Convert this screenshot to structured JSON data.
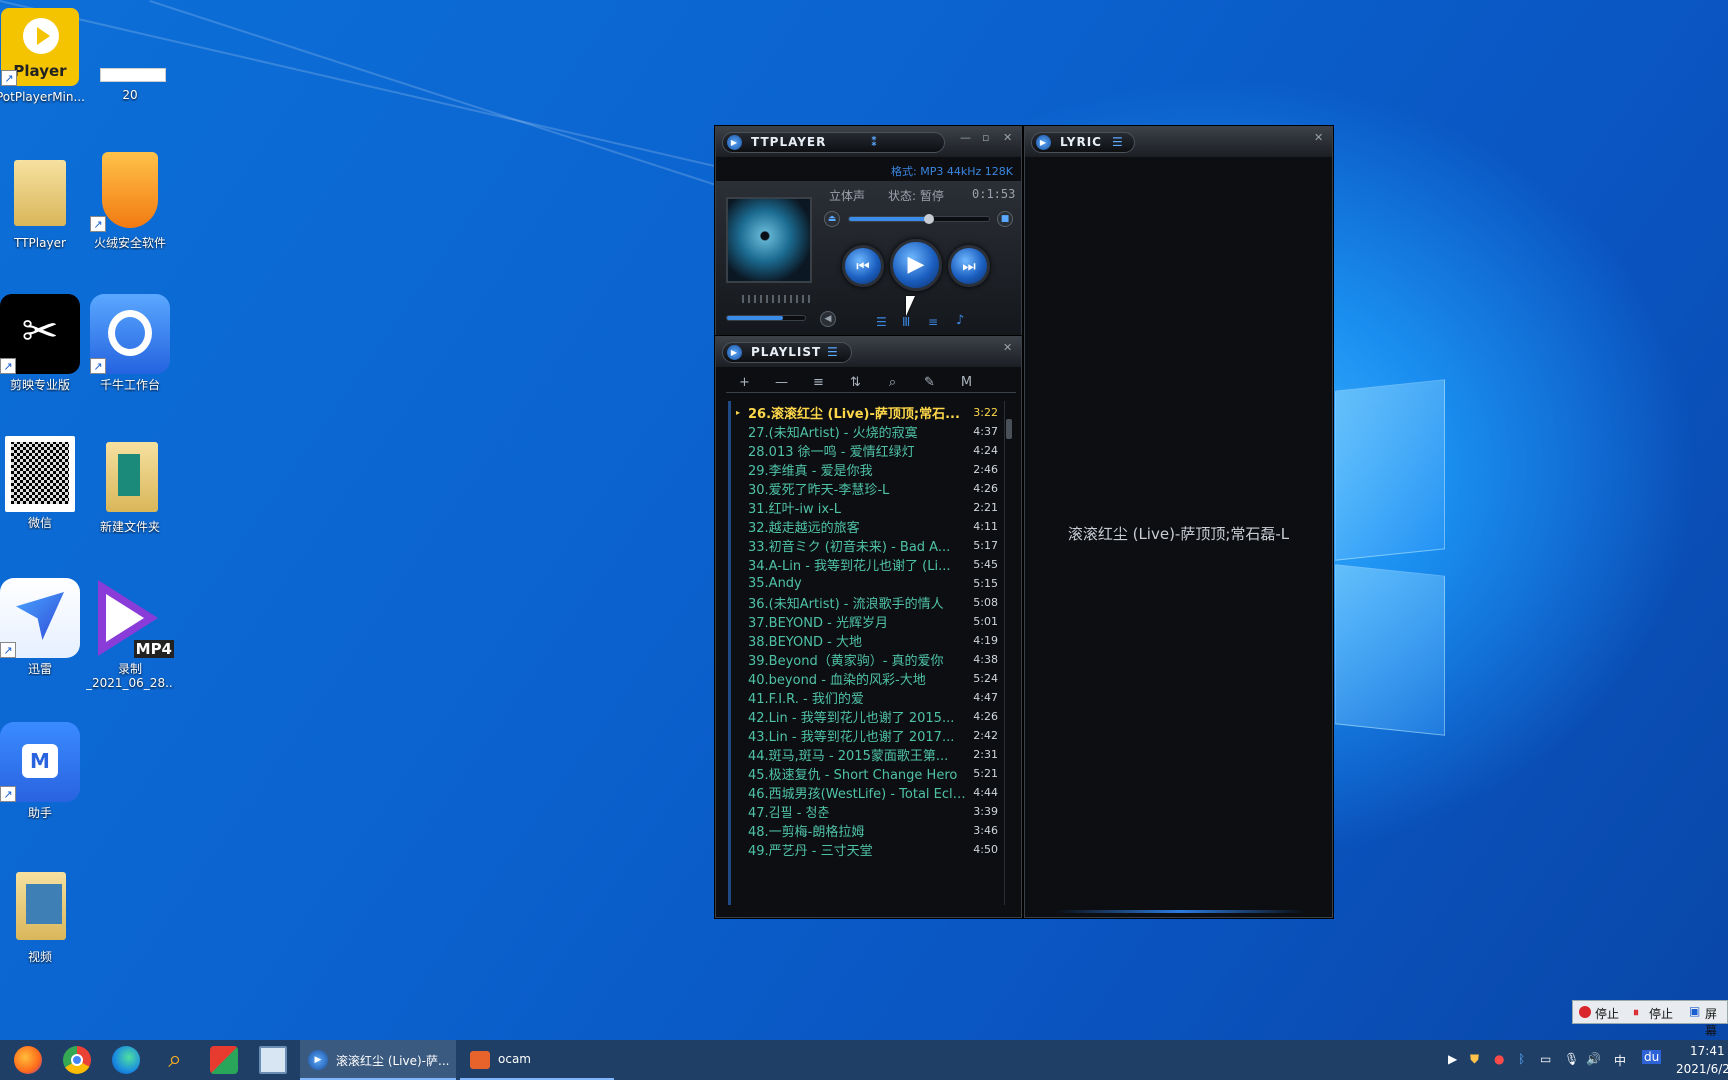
{
  "desktop_icons": [
    {
      "label": "PotPlayerMin...",
      "tile_text": "Player",
      "has_shortcut": true
    },
    {
      "label": "20",
      "has_shortcut": false
    },
    {
      "label": "TTPlayer",
      "has_shortcut": false
    },
    {
      "label": "火绒安全软件",
      "has_shortcut": true
    },
    {
      "label": "剪映专业版",
      "has_shortcut": true
    },
    {
      "label": "千牛工作台",
      "has_shortcut": true
    },
    {
      "label": "微信",
      "has_shortcut": false
    },
    {
      "label": "新建文件夹",
      "has_shortcut": false
    },
    {
      "label": "迅雷",
      "has_shortcut": true
    },
    {
      "label": "录制\n_2021_06_28...",
      "tile_text": "MP4",
      "has_shortcut": false
    },
    {
      "label": "助手",
      "has_shortcut": true
    },
    {
      "label": "视频",
      "has_shortcut": false
    }
  ],
  "player": {
    "title": "TTPLAYER",
    "format": "格式: MP3 44kHz 128K",
    "channel": "立体声",
    "status": "状态: 暂停",
    "time": "0:1:53",
    "seek_fraction": 0.57,
    "volume_fraction": 0.72,
    "buttons": {
      "prev": "⏮",
      "play": "▶",
      "next": "⏭"
    }
  },
  "playlist": {
    "title": "PLAYLIST",
    "tools": [
      "+",
      "—",
      "≡",
      "⇅",
      "⌕",
      "✎",
      "M"
    ],
    "items": [
      {
        "title": "26.滚滚红尘 (Live)-萨顶顶;常石...",
        "duration": "3:22",
        "active": true
      },
      {
        "title": "27.(未知Artist) - 火烧的寂寞",
        "duration": "4:37"
      },
      {
        "title": "28.013 徐一鸣 - 爱情红绿灯",
        "duration": "4:24"
      },
      {
        "title": "29.李维真 - 爱是你我",
        "duration": "2:46"
      },
      {
        "title": "30.爱死了昨天-李慧珍-L",
        "duration": "4:26"
      },
      {
        "title": "31.红叶-iw ix-L",
        "duration": "2:21"
      },
      {
        "title": "32.越走越远的旅客",
        "duration": "4:11"
      },
      {
        "title": "33.初音ミク (初音未来) - Bad A...",
        "duration": "5:17"
      },
      {
        "title": "34.A-Lin - 我等到花儿也谢了 (Li...",
        "duration": "5:45"
      },
      {
        "title": "35.Andy",
        "duration": "5:15"
      },
      {
        "title": "36.(未知Artist) - 流浪歌手的情人",
        "duration": "5:08"
      },
      {
        "title": "37.BEYOND - 光辉岁月",
        "duration": "5:01"
      },
      {
        "title": "38.BEYOND - 大地",
        "duration": "4:19"
      },
      {
        "title": "39.Beyond（黄家驹）- 真的爱你",
        "duration": "4:38"
      },
      {
        "title": "40.beyond - 血染的风彩-大地",
        "duration": "5:24"
      },
      {
        "title": "41.F.I.R. - 我们的爱",
        "duration": "4:47"
      },
      {
        "title": "42.Lin - 我等到花儿也谢了 2015...",
        "duration": "4:26"
      },
      {
        "title": "43.Lin - 我等到花儿也谢了 2017...",
        "duration": "2:42"
      },
      {
        "title": "44.斑马,斑马 - 2015蒙面歌王第...",
        "duration": "2:31"
      },
      {
        "title": "45.极速复仇 - Short Change Hero",
        "duration": "5:21"
      },
      {
        "title": "46.西城男孩(WestLife) - Total Ecli...",
        "duration": "4:44"
      },
      {
        "title": "47.김필 - 청춘",
        "duration": "3:39"
      },
      {
        "title": "48.一剪梅-朗格拉姆",
        "duration": "3:46"
      },
      {
        "title": "49.严艺丹 - 三寸天堂",
        "duration": "4:50"
      }
    ]
  },
  "lyric": {
    "title": "LYRIC",
    "text": "滚滚红尘 (Live)-萨顶顶;常石磊-L"
  },
  "recorder": {
    "stop1": "停止",
    "stop2": "停止",
    "screen": "屏幕"
  },
  "taskbar": {
    "apps": [
      "firefox-icon",
      "chrome-icon",
      "edge-icon",
      "search-app-icon",
      "wps-icon",
      "desktop-app-icon"
    ],
    "tasks": [
      {
        "label": "滚滚红尘 (Live)-萨...",
        "active": true
      },
      {
        "label": "ocam",
        "active": false
      }
    ],
    "ime": "中",
    "baidu": "du",
    "time": "17:41",
    "date": "2021/6/2"
  },
  "colors": {
    "accent": "#ffd84a",
    "playlist_text": "#4fc2a6",
    "taskbar": "#1f3f66"
  }
}
